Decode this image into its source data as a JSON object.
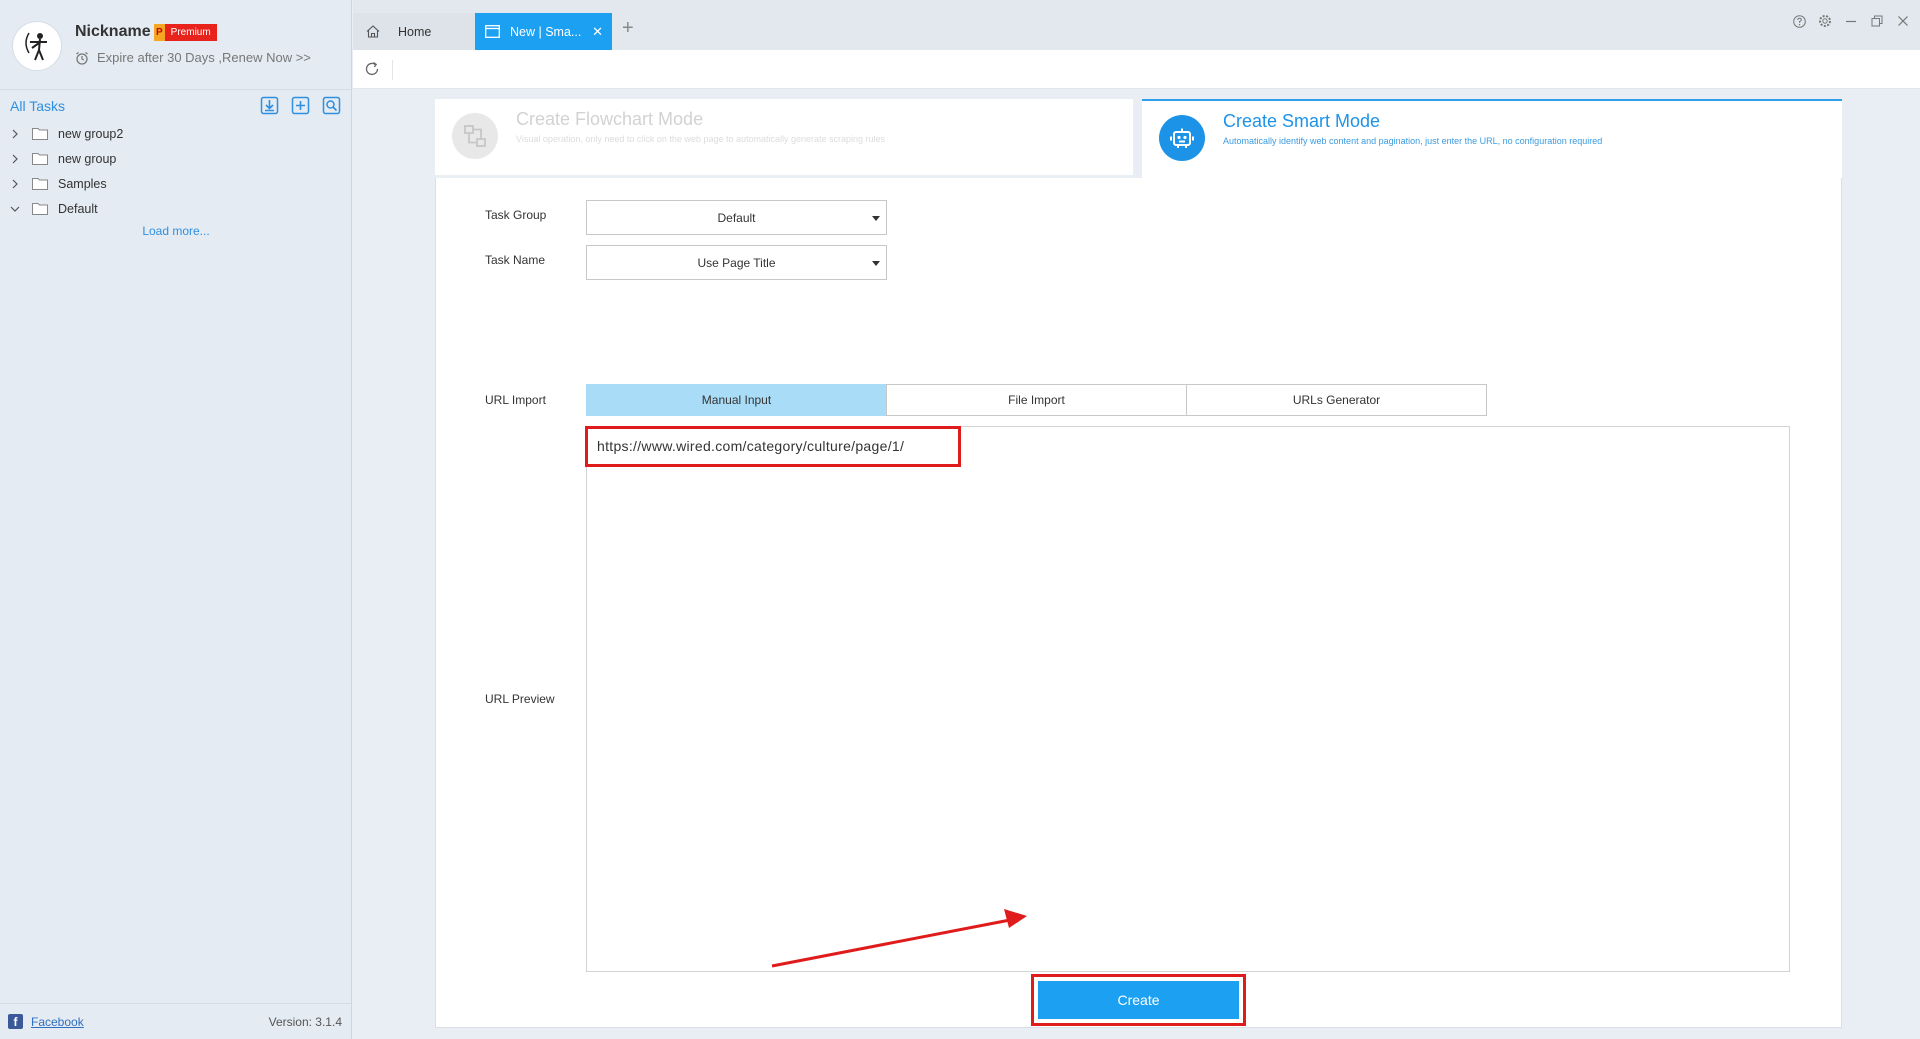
{
  "user": {
    "nickname": "Nickname",
    "badge_p": "P",
    "badge_label": "Premium",
    "expire_text": "Expire after 30 Days ,Renew Now >>"
  },
  "sidebar": {
    "all_tasks_label": "All Tasks",
    "tools": [
      "import-icon",
      "add-task-icon",
      "search-task-icon"
    ],
    "groups": [
      {
        "label": "new group2",
        "expanded": false
      },
      {
        "label": "new group",
        "expanded": false
      },
      {
        "label": "Samples",
        "expanded": false
      },
      {
        "label": "Default",
        "expanded": true
      }
    ],
    "load_more": "Load more...",
    "footer_link": "Facebook",
    "version": "Version: 3.1.4"
  },
  "tabs": {
    "home_label": "Home",
    "active_label": "New | Sma...",
    "add_symbol": "+"
  },
  "modes": {
    "flowchart": {
      "title": "Create Flowchart Mode",
      "desc": "Visual operation, only need to click on the web page to automatically generate scraping rules"
    },
    "smart": {
      "title": "Create Smart Mode",
      "desc": "Automatically identify web content and pagination, just enter the URL, no configuration required"
    }
  },
  "form": {
    "task_group_label": "Task Group",
    "task_group_value": "Default",
    "task_name_label": "Task Name",
    "task_name_value": "Use Page Title",
    "url_import_label": "URL Import",
    "url_import_tabs": [
      "Manual Input",
      "File Import",
      "URLs Generator"
    ],
    "active_import_tab": 0,
    "url_preview_label": "URL Preview",
    "url_value": "https://www.wired.com/category/culture/page/1/",
    "create_label": "Create"
  },
  "colors": {
    "accent": "#1ca0f2",
    "highlight": "#e01b1b",
    "active_tab": "#a9dcf6"
  }
}
